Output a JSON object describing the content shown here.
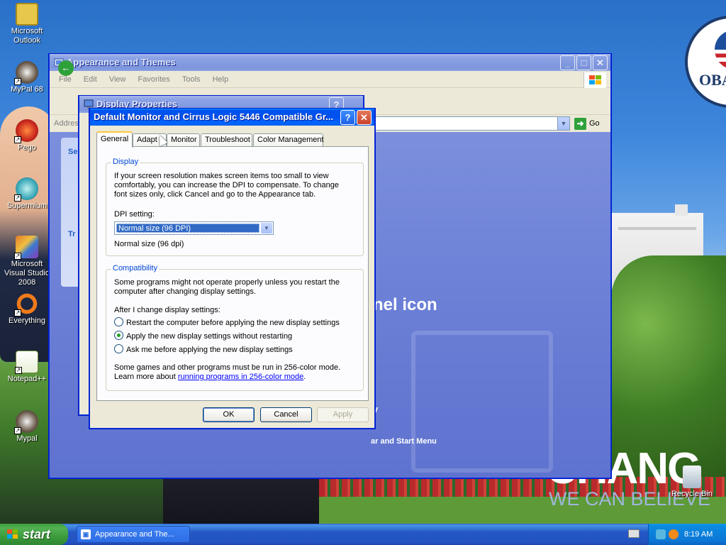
{
  "desktop": {
    "icons": [
      {
        "label": "Microsoft Outlook",
        "icon": "outlook-icon"
      },
      {
        "label": "MyPal 68",
        "icon": "mypal-icon"
      },
      {
        "label": "Pego",
        "icon": "pego-icon"
      },
      {
        "label": "Supermium",
        "icon": "supermium-icon"
      },
      {
        "label": "Microsoft Visual Studio 2008",
        "icon": "visual-studio-icon"
      },
      {
        "label": "Everything",
        "icon": "everything-icon"
      },
      {
        "label": "Notepad++",
        "icon": "notepadpp-icon"
      },
      {
        "label": "Mypal",
        "icon": "mypal-icon"
      }
    ],
    "wallpaper": {
      "headline": "CHANG",
      "subline": "WE CAN BELIEVE",
      "logo_text": "OBA"
    },
    "recycle_bin_label": "Recycle Bin"
  },
  "explorer": {
    "title": "Appearance and Themes",
    "menu": [
      "File",
      "Edit",
      "View",
      "Favorites",
      "Tools",
      "Help"
    ],
    "address_label": "Addres",
    "go_label": "Go",
    "taskpane_heads": [
      "Se",
      "Tr"
    ],
    "content_big": "nel icon",
    "content_small": "ar and Start Menu",
    "content_mark": "y"
  },
  "display_properties": {
    "title": "Display Properties"
  },
  "monitor_dialog": {
    "title": "Default Monitor and Cirrus Logic 5446 Compatible Gr...",
    "tabs": [
      "General",
      "Adapt",
      "Monitor",
      "Troubleshoot",
      "Color Management"
    ],
    "display_group": {
      "legend": "Display",
      "text_lines": [
        "If your screen resolution makes screen items too small to view",
        "comfortably, you can increase the DPI to compensate.  To change",
        "font sizes only, click Cancel and go to the Appearance tab."
      ],
      "dpi_label": "DPI setting:",
      "dpi_value": "Normal size (96 DPI)",
      "dpi_note": "Normal size (96 dpi)"
    },
    "compat_group": {
      "legend": "Compatibility",
      "text_lines": [
        "Some programs might not operate properly unless you restart the",
        "computer after changing display settings."
      ],
      "after_label": "After I change display settings:",
      "options": [
        {
          "label": "Restart the computer before applying the new display settings",
          "checked": false
        },
        {
          "label": "Apply the new display settings without restarting",
          "checked": true
        },
        {
          "label": "Ask me before applying the new display settings",
          "checked": false
        }
      ],
      "games_line": "Some games and other programs must be run in 256-color mode.",
      "learn_prefix": "Learn more about ",
      "learn_link": "running programs in 256-color mode",
      "learn_suffix": "."
    },
    "buttons": {
      "ok": "OK",
      "cancel": "Cancel",
      "apply": "Apply"
    }
  },
  "taskbar": {
    "start_label": "start",
    "task_item": "Appearance and The...",
    "clock": "8:19 AM"
  }
}
